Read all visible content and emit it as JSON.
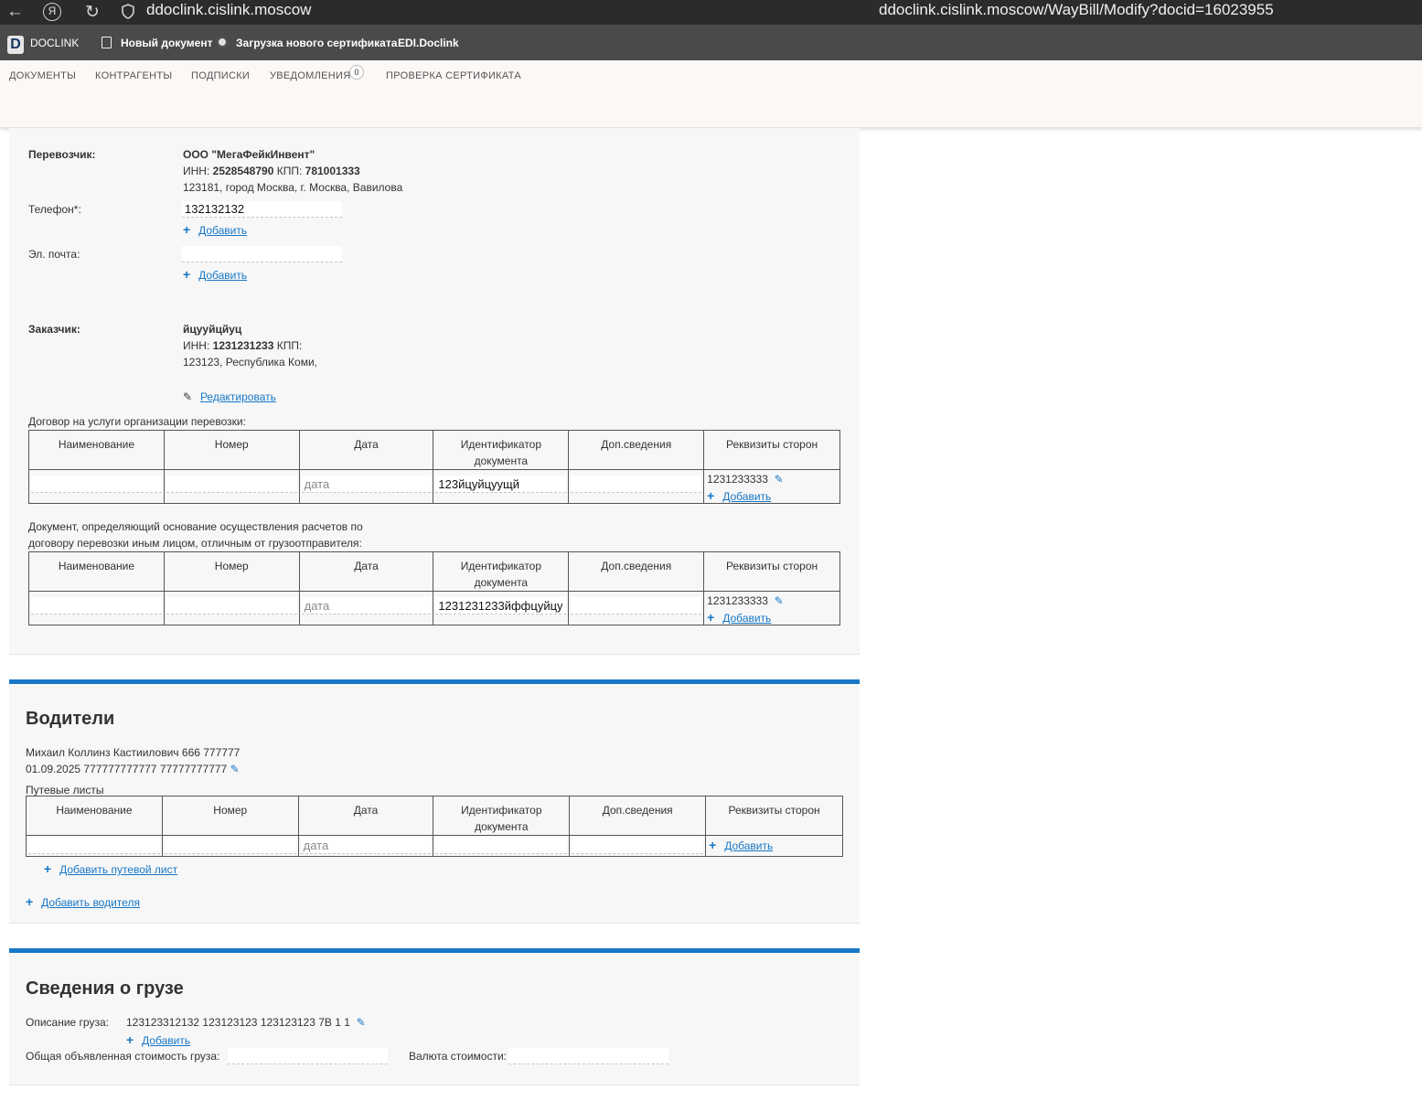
{
  "browser": {
    "url_short": "ddoclink.cislink.moscow",
    "url_full": "ddoclink.cislink.moscow/WayBill/Modify?docid=16023955",
    "ya_glyph": "Я"
  },
  "appbar": {
    "logo_letter": "D",
    "logo_text": "DOCLINK",
    "new_doc": "Новый документ",
    "upload_cert": "Загрузка нового сертификата",
    "edi": "EDI.Doclink"
  },
  "nav": {
    "documents": "ДОКУМЕНТЫ",
    "counterparties": "КОНТРАГЕНТЫ",
    "subscriptions": "ПОДПИСКИ",
    "notifications": "УВЕДОМЛЕНИЯ",
    "notifications_count": "0",
    "check_cert": "ПРОВЕРКА СЕРТИФИКАТА"
  },
  "carrier": {
    "label": "Перевозчик:",
    "name": "ООО \"МегаФейкИнвент\"",
    "inn_label": "ИНН:",
    "inn": "2528548790",
    "kpp_label": "КПП:",
    "kpp": "781001333",
    "address": "123181, город Москва, г. Москва, Вавилова",
    "phone_label": "Телефон*:",
    "phone_value": "132132132",
    "email_label": "Эл. почта:",
    "email_value": "",
    "add_label": "Добавить"
  },
  "customer": {
    "label": "Заказчик:",
    "name": "йцууйцйуц",
    "inn_label": "ИНН:",
    "inn": "1231231233",
    "kpp_label": "КПП:",
    "address": "123123, Республика Коми,",
    "edit_label": "Редактировать"
  },
  "contract": {
    "caption": "Договор на услуги организации перевозки:",
    "headers": [
      "Наименование",
      "Номер",
      "Дата",
      "Идентификатор документа",
      "Доп.сведения",
      "Реквизиты сторон"
    ],
    "row": {
      "name": "",
      "number": "",
      "date_placeholder": "дата",
      "identifier": "123йцуйцуущй",
      "extra": "",
      "requisites": "1231233333",
      "add_label": "Добавить"
    }
  },
  "basis_doc": {
    "caption_line1": "Документ, определяющий основание осуществления расчетов по",
    "caption_line2": "договору перевозки иным лицом, отличным от грузоотправителя:",
    "headers": [
      "Наименование",
      "Номер",
      "Дата",
      "Идентификатор документа",
      "Доп.сведения",
      "Реквизиты сторон"
    ],
    "row": {
      "name": "",
      "number": "",
      "date_placeholder": "дата",
      "identifier": "1231231233йффцуйцу",
      "extra": "",
      "requisites": "1231233333",
      "add_label": "Добавить"
    }
  },
  "drivers": {
    "title": "Водители",
    "driver_line1": "Михаил Коллинз Кастиилович 666 777777",
    "driver_line2": "01.09.2025 777777777777 77777777777",
    "waybills_caption": "Путевые листы",
    "headers": [
      "Наименование",
      "Номер",
      "Дата",
      "Идентификатор документа",
      "Доп.сведения",
      "Реквизиты сторон"
    ],
    "row": {
      "date_placeholder": "дата",
      "add_label": "Добавить"
    },
    "add_waybill": "Добавить путевой лист",
    "add_driver": "Добавить водителя"
  },
  "cargo": {
    "title": "Сведения о грузе",
    "desc_label": "Описание груза:",
    "desc_value": "123123312132 123123123 123123123 7В 1 1",
    "add_label": "Добавить",
    "total_cost_label": "Общая объявленная стоимость груза:",
    "total_cost_value": "",
    "currency_label": "Валюта стоимости:",
    "currency_value": ""
  },
  "colors": {
    "accent": "#1677c7",
    "panel_bg": "#f7f7f7",
    "nav_bg": "#fcf8f6",
    "appbar_bg": "#4a4a4a",
    "browser_bg": "#2b2b2e"
  }
}
